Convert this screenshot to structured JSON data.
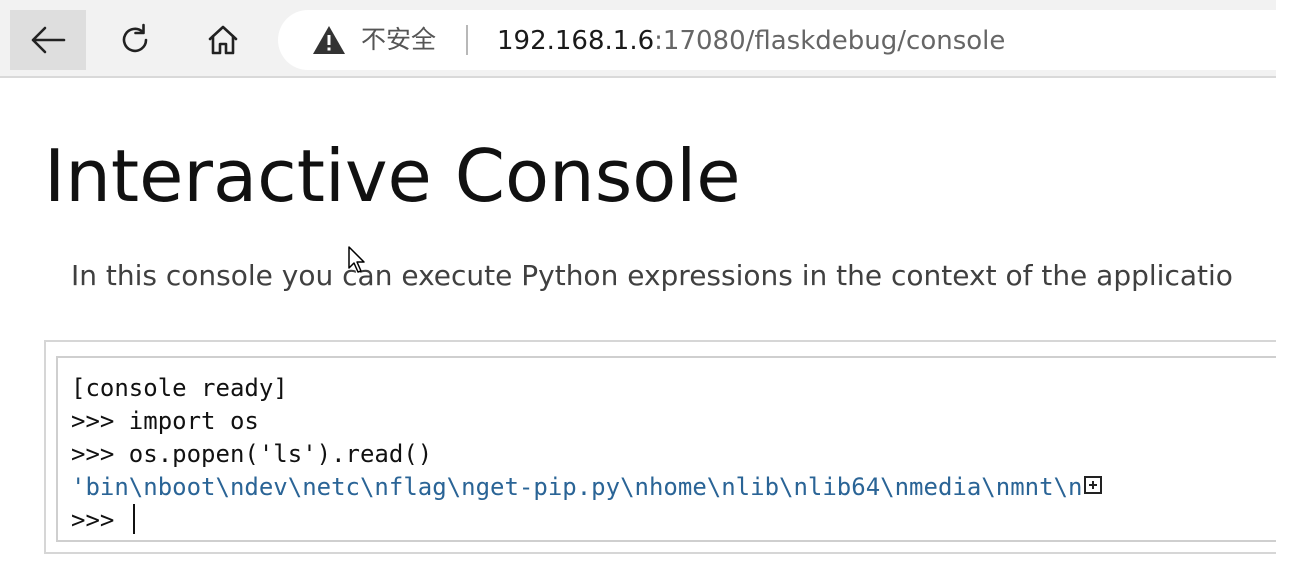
{
  "browser": {
    "security_label": "不安全",
    "url_host": "192.168.1.6",
    "url_rest": ":17080/flaskdebug/console",
    "icons": [
      "back-arrow-icon",
      "reload-icon",
      "home-icon",
      "warning-icon"
    ]
  },
  "page": {
    "title": "Interactive Console",
    "intro": "In this console you can execute Python expressions in the context of the applicatio"
  },
  "console": {
    "lines": [
      "[console ready]",
      ">>> import os",
      ">>> os.popen('ls').read()",
      "'bin\\nboot\\ndev\\netc\\nflag\\nget-pip.py\\nhome\\nlib\\nlib64\\nmedia\\nmnt\\n"
    ],
    "prompt": ">>> ",
    "output_color": "#2a6496"
  }
}
